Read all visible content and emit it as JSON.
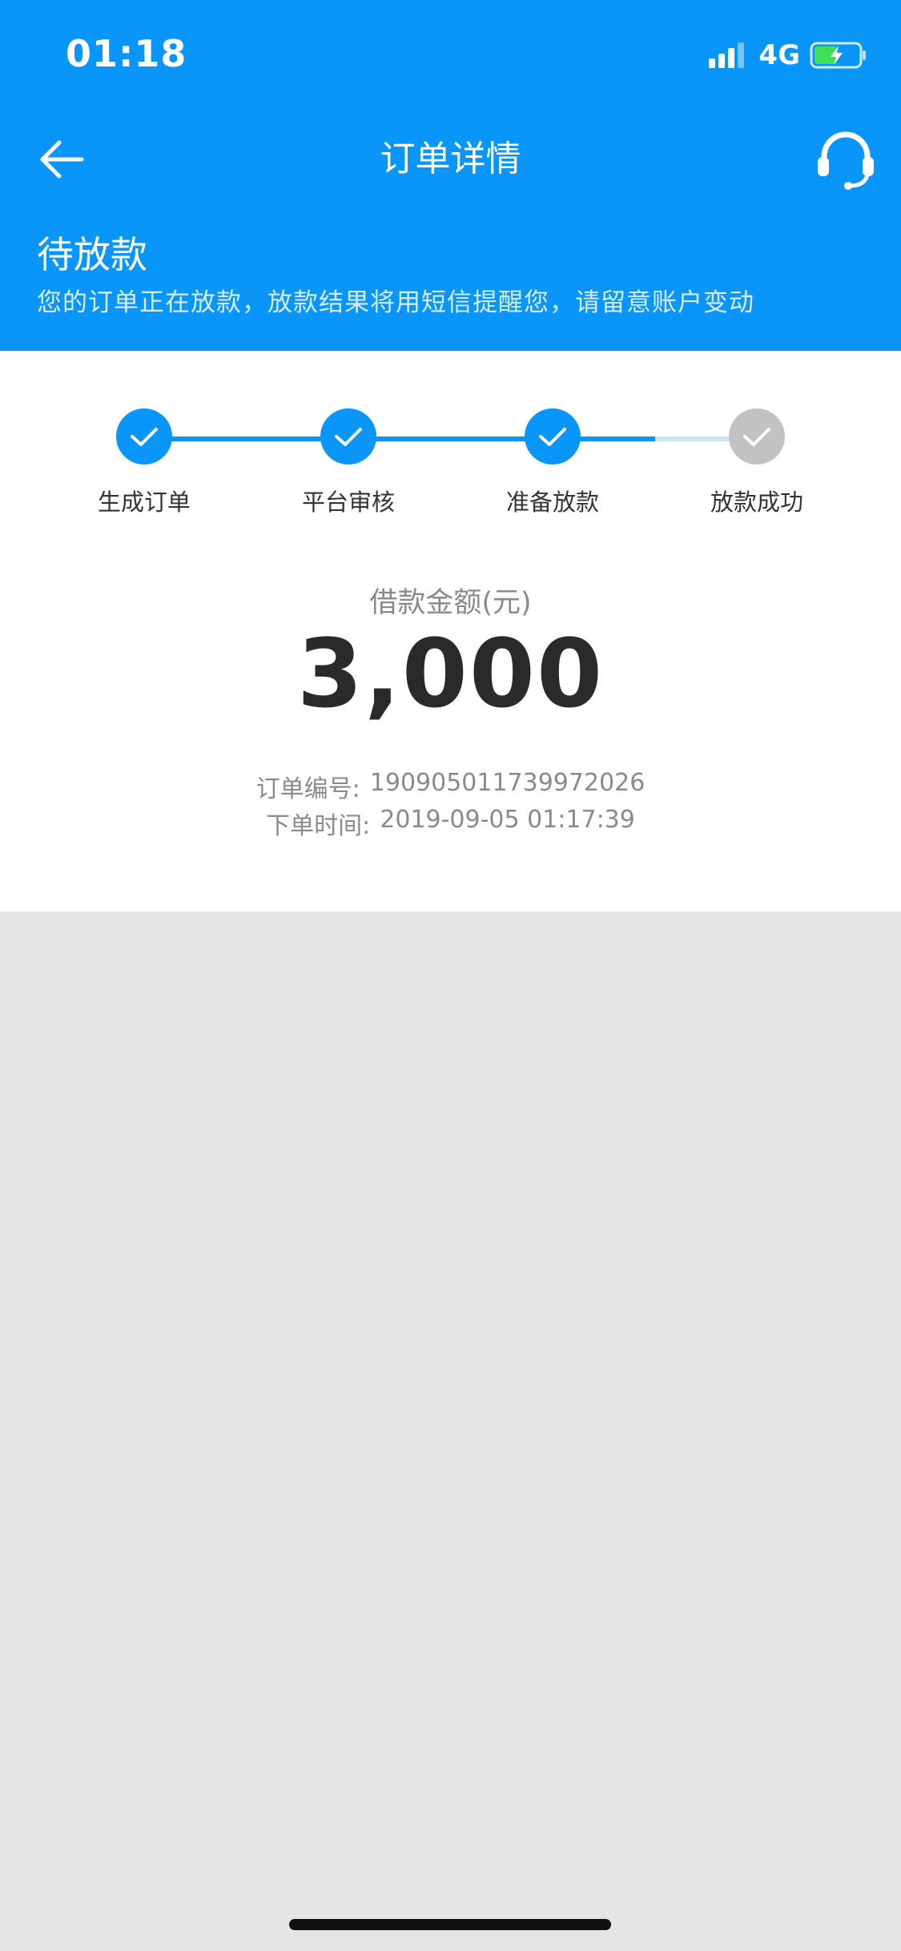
{
  "status_bar": {
    "time": "01:18",
    "network": "4G"
  },
  "nav": {
    "title": "订单详情",
    "back_icon": "arrow-left-icon",
    "service_icon": "headset-icon"
  },
  "order_status": {
    "title": "待放款",
    "description": "您的订单正在放款，放款结果将用短信提醒您，请留意账户变动"
  },
  "steps": [
    {
      "label": "生成订单",
      "done": true
    },
    {
      "label": "平台审核",
      "done": true
    },
    {
      "label": "准备放款",
      "done": true
    },
    {
      "label": "放款成功",
      "done": false
    }
  ],
  "amount": {
    "label": "借款金额(元)",
    "value": "3,000"
  },
  "order_info": {
    "number_label": "订单编号:",
    "number_value": "190905011739972026",
    "time_label": "下单时间:",
    "time_value": "2019-09-05 01:17:39"
  },
  "colors": {
    "primary": "#0a96f8",
    "pending_step": "#c2c2c2",
    "background": "#e5e5e5"
  }
}
